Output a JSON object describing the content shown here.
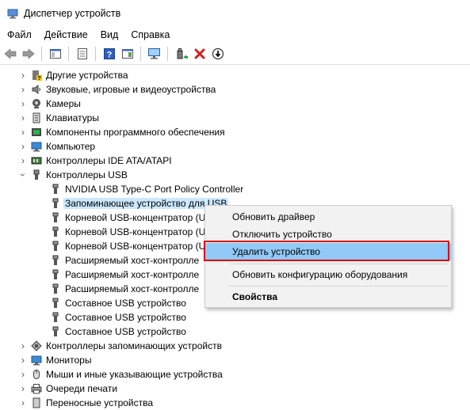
{
  "window": {
    "title": "Диспетчер устройств"
  },
  "menu": [
    "Файл",
    "Действие",
    "Вид",
    "Справка"
  ],
  "toolbar": [
    "back-icon",
    "forward-icon",
    "properties-icon",
    "help-icon",
    "scan-hardware-icon",
    "update-driver-icon",
    "uninstall-icon",
    "disable-icon"
  ],
  "tree": {
    "categories_top": [
      "Другие устройства",
      "Звуковые, игровые и видеоустройства",
      "Камеры",
      "Клавиатуры",
      "Компоненты программного обеспечения",
      "Компьютер",
      "Контроллеры IDE ATA/ATAPI",
      "Контроллеры USB"
    ],
    "usb_children": [
      "NVIDIA USB Type-C Port Policy Controller",
      "Запоминающее устройство для USB",
      "Корневой USB-концентратор (U",
      "Корневой USB-концентратор (U",
      "Корневой USB-концентратор (U",
      "Расширяемый хост-контролле",
      "Расширяемый хост-контролле",
      "Расширяемый хост-контролле",
      "Составное USB устройство",
      "Составное USB устройство",
      "Составное USB устройство"
    ],
    "categories_bottom": [
      "Контроллеры запоминающих устройств",
      "Мониторы",
      "Мыши и иные указывающие устройства",
      "Очереди печати",
      "Переносные устройства"
    ],
    "selected_index": 1
  },
  "context_menu": {
    "items": [
      "Обновить драйвер",
      "Отключить устройство",
      "Удалить устройство",
      "Обновить конфигурацию оборудования",
      "Свойства"
    ],
    "highlighted": "Удалить устройство"
  },
  "colors": {
    "selection": "#cce8ff",
    "menu_highlight": "#91c9f7",
    "annotation_box": "#d90000"
  }
}
